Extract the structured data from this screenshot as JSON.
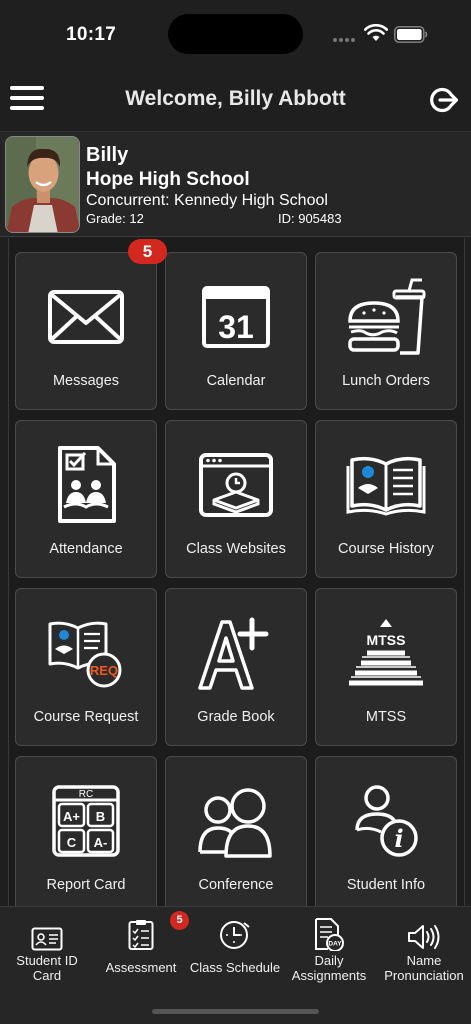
{
  "status": {
    "time": "10:17"
  },
  "header": {
    "title": "Welcome, Billy Abbott"
  },
  "profile": {
    "name": "Billy",
    "school": "Hope High School",
    "concurrent": "Concurrent: Kennedy High School",
    "grade": "Grade: 12",
    "id": "ID: 905483"
  },
  "tiles": [
    {
      "label": "Messages",
      "icon": "envelope-icon",
      "badge": "5"
    },
    {
      "label": "Calendar",
      "icon": "calendar-icon",
      "day": "31"
    },
    {
      "label": "Lunch Orders",
      "icon": "burger-drink-icon"
    },
    {
      "label": "Attendance",
      "icon": "attendance-clipboard-icon"
    },
    {
      "label": "Class Websites",
      "icon": "browser-clock-icon"
    },
    {
      "label": "Course History",
      "icon": "open-book-icon"
    },
    {
      "label": "Course Request",
      "icon": "book-req-icon",
      "req": "REQ"
    },
    {
      "label": "Grade Book",
      "icon": "a-plus-icon"
    },
    {
      "label": "MTSS",
      "icon": "pyramid-icon",
      "text": "MTSS"
    },
    {
      "label": "Report Card",
      "icon": "report-card-icon",
      "rc": "RC",
      "grades": [
        "A+",
        "B",
        "C",
        "A-"
      ]
    },
    {
      "label": "Conference",
      "icon": "people-icon"
    },
    {
      "label": "Student Info",
      "icon": "person-info-icon"
    }
  ],
  "tabs": [
    {
      "label": "Student ID Card",
      "line1": "Student ID",
      "line2": "Card",
      "icon": "id-card-icon"
    },
    {
      "label": "Assessment",
      "line1": "Assessment",
      "line2": "",
      "icon": "checklist-icon",
      "badge": "5"
    },
    {
      "label": "Class Schedule",
      "line1": "Class Schedule",
      "line2": "",
      "icon": "clock-icon"
    },
    {
      "label": "Daily Assignments",
      "line1": "Daily",
      "line2": "Assignments",
      "icon": "day-document-icon",
      "day": "DAY"
    },
    {
      "label": "Name Pronunciation",
      "line1": "Name",
      "line2": "Pronunciation",
      "icon": "speaker-icon"
    }
  ]
}
